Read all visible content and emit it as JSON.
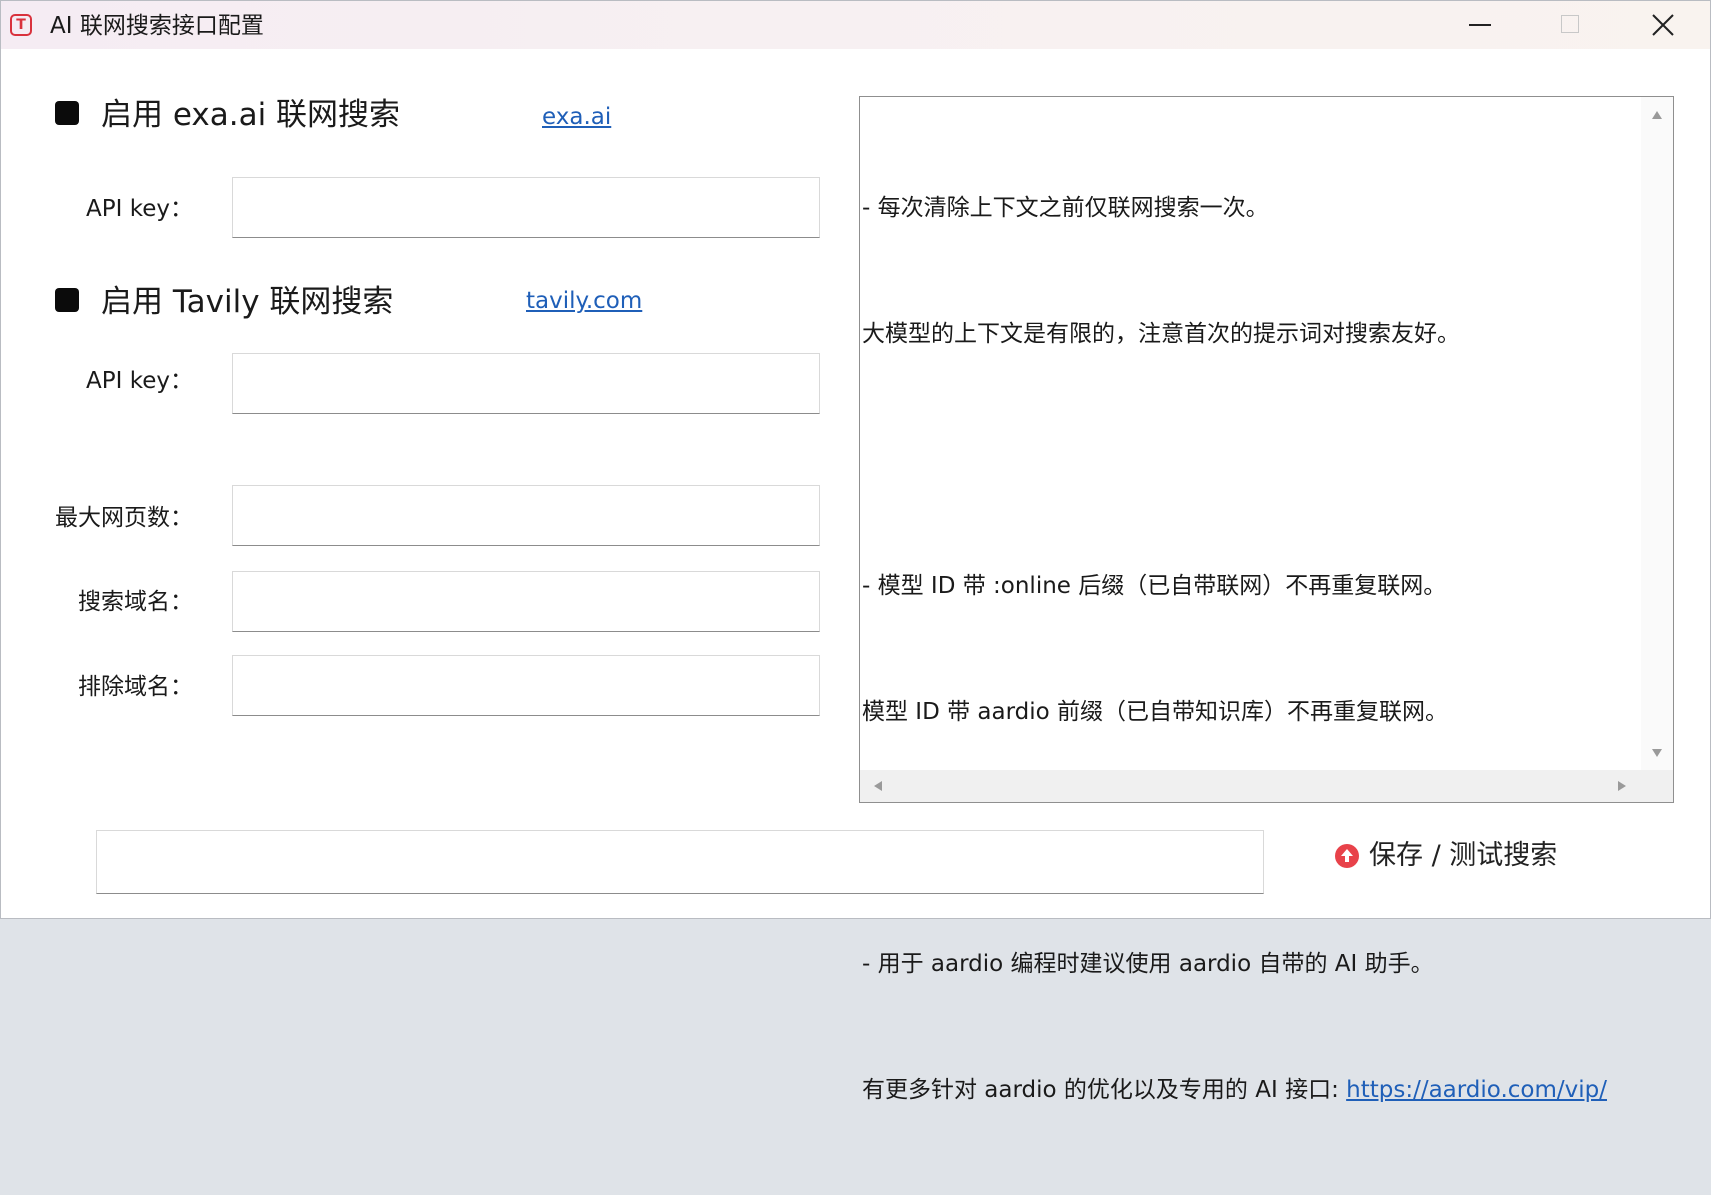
{
  "window": {
    "title": "AI 联网搜索接口配置",
    "app_icon_glyph": "T",
    "accent_color": "#d9323d",
    "controls": [
      "minimize",
      "maximize",
      "close"
    ]
  },
  "exa": {
    "enable_label": "启用 exa.ai 联网搜索",
    "checked": true,
    "link": "exa.ai",
    "api_key_label": "API key：",
    "api_key_value": ""
  },
  "tavily": {
    "enable_label": "启用 Tavily 联网搜索",
    "checked": true,
    "link": "tavily.com",
    "api_key_label": "API key：",
    "api_key_value": ""
  },
  "options": {
    "max_pages_label": "最大网页数：",
    "max_pages_value": "",
    "include_domains_label": "搜索域名：",
    "include_domains_value": "",
    "exclude_domains_label": "排除域名：",
    "exclude_domains_value": ""
  },
  "info": {
    "lines": [
      "- 每次清除上下文之前仅联网搜索一次。",
      "大模型的上下文是有限的，注意首次的提示词对搜索友好。",
      "",
      "- 模型 ID 带 :online 后缀（已自带联网）不再重复联网。",
      "模型 ID 带 aardio 前缀（已自带知识库）不再重复联网。",
      "",
      "- 用于 aardio 编程时建议使用 aardio 自带的 AI 助手。"
    ],
    "last_line_prefix": "有更多针对 aardio 的优化以及专用的 AI 接口: ",
    "last_line_link": "https://aardio.com/vip/"
  },
  "footer": {
    "query_value": "",
    "save_test_label": "保存 / 测试搜索",
    "save_icon": "upload-arrow-icon",
    "save_icon_color": "#e8424a"
  }
}
